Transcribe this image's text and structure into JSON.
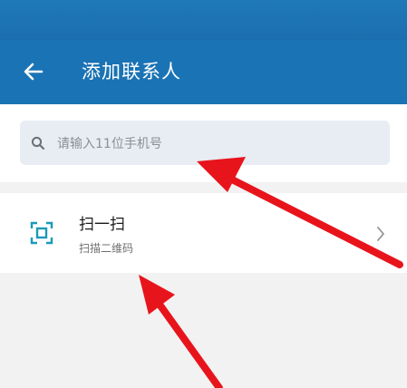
{
  "header": {
    "title": "添加联系人",
    "back_icon": "back-arrow-icon",
    "color": "#1a73b4"
  },
  "search": {
    "placeholder": "请输入11位手机号",
    "icon": "search-icon"
  },
  "scan": {
    "title": "扫一扫",
    "subtitle": "扫描二维码",
    "icon": "qr-scan-icon",
    "chevron_icon": "chevron-right-icon",
    "accent_color": "#1a9ab8"
  },
  "annotation_color": "#e8141c"
}
